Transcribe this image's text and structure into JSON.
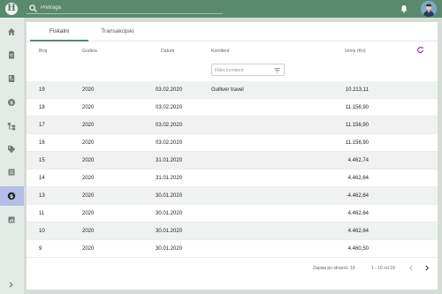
{
  "app": {
    "logo_letter": "H"
  },
  "search": {
    "placeholder": "Pretraga"
  },
  "sidebar": {
    "items": [
      {
        "icon": "home-icon"
      },
      {
        "icon": "clipboard-icon"
      },
      {
        "icon": "document-icon"
      },
      {
        "icon": "coin-icon"
      },
      {
        "icon": "hierarchy-icon"
      },
      {
        "icon": "tag-icon"
      },
      {
        "icon": "list-icon"
      },
      {
        "icon": "dollar-icon",
        "active": true
      },
      {
        "icon": "report-icon"
      }
    ]
  },
  "tabs": [
    {
      "label": "Fiskalni",
      "active": true
    },
    {
      "label": "Transakcijski"
    }
  ],
  "table": {
    "columns": {
      "broj": "Broj",
      "godina": "Godina",
      "datum": "Datum",
      "komitent": "Komitent",
      "iznos": "Iznos (Kn)"
    },
    "filter_placeholder": "Filter komitent",
    "rows": [
      {
        "broj": "19",
        "godina": "2020",
        "datum": "03.02.2020",
        "komitent": "Gulliver travel",
        "iznos": "10.213,11"
      },
      {
        "broj": "18",
        "godina": "2020",
        "datum": "03.02.2020",
        "komitent": "",
        "iznos": "11.156,90"
      },
      {
        "broj": "17",
        "godina": "2020",
        "datum": "03.02.2020",
        "komitent": "",
        "iznos": "11.156,90"
      },
      {
        "broj": "16",
        "godina": "2020",
        "datum": "03.02.2020",
        "komitent": "",
        "iznos": "11.156,90"
      },
      {
        "broj": "15",
        "godina": "2020",
        "datum": "31.01.2020",
        "komitent": "",
        "iznos": "4.462,74"
      },
      {
        "broj": "14",
        "godina": "2020",
        "datum": "31.01.2020",
        "komitent": "",
        "iznos": "4.462,64"
      },
      {
        "broj": "13",
        "godina": "2020",
        "datum": "30.01.2020",
        "komitent": "",
        "iznos": "-4.462,64"
      },
      {
        "broj": "11",
        "godina": "2020",
        "datum": "30.01.2020",
        "komitent": "",
        "iznos": "4.462,64"
      },
      {
        "broj": "10",
        "godina": "2020",
        "datum": "30.01.2020",
        "komitent": "",
        "iznos": "4.462,64"
      },
      {
        "broj": "9",
        "godina": "2020",
        "datum": "30.01.2020",
        "komitent": "",
        "iznos": "4.460,50"
      }
    ]
  },
  "pagination": {
    "per_page_label": "Zapisa po stranici:",
    "per_page": "10",
    "range": "1 - 10 od 19"
  },
  "colors": {
    "topbar": "#5a8a6e",
    "sidebar_active": "#b3bfe8",
    "refresh": "#8e24aa"
  }
}
